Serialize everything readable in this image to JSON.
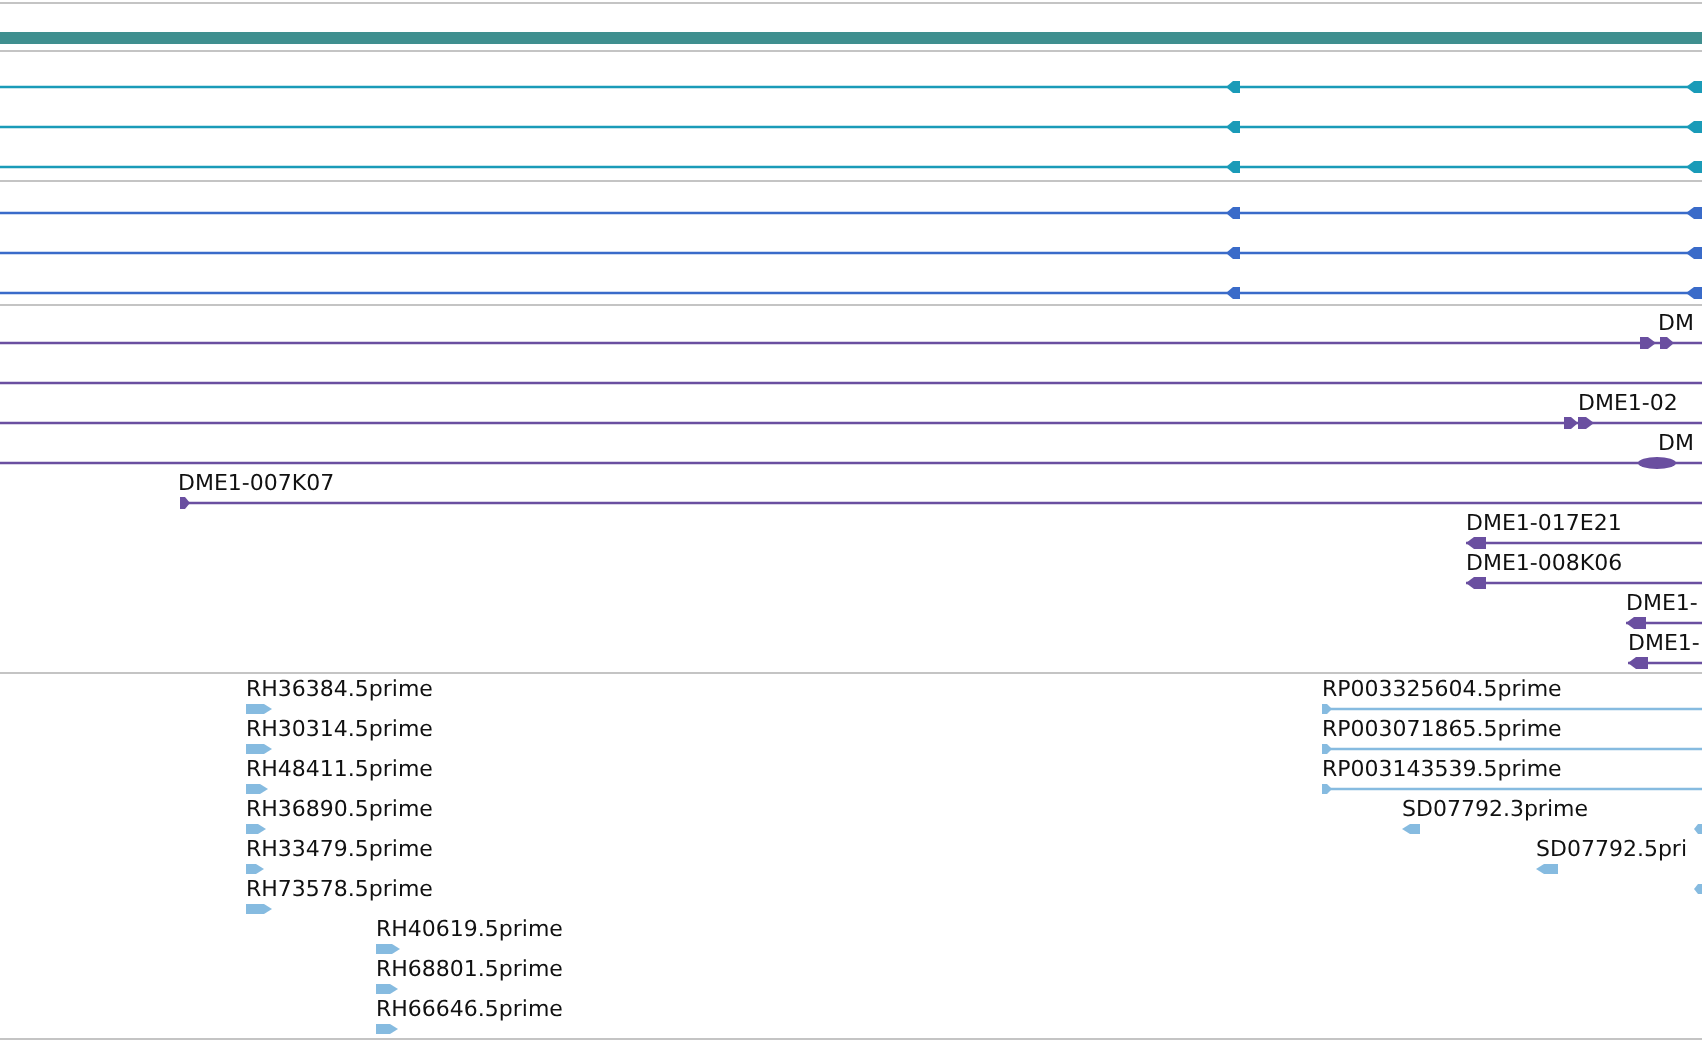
{
  "tracks": [
    {
      "color": "#1a9bb8",
      "features": [
        {
          "kind": "reverse"
        },
        {
          "kind": "reverse"
        },
        {
          "kind": "reverse"
        }
      ]
    },
    {
      "color": "#3a6bc9",
      "features": [
        {
          "kind": "reverse"
        },
        {
          "kind": "reverse"
        },
        {
          "kind": "reverse"
        }
      ]
    },
    {
      "color": "#6a4fa0",
      "features": [
        {
          "label": "DM",
          "kind": "forward"
        },
        {
          "kind": "forward"
        },
        {
          "label": "DME1-02",
          "kind": "forward"
        },
        {
          "label": "DM",
          "kind": "forward"
        },
        {
          "label": "DME1-007K07",
          "kind": "forward"
        },
        {
          "label": "DME1-017E21",
          "kind": "reverse"
        },
        {
          "label": "DME1-008K06",
          "kind": "reverse"
        },
        {
          "label": "DME1-",
          "kind": "reverse"
        },
        {
          "label": "DME1-",
          "kind": "reverse"
        }
      ]
    },
    {
      "color": "#86bbe0",
      "features": [
        {
          "label": "RH36384.5prime",
          "kind": "forward"
        },
        {
          "label": "RH30314.5prime",
          "kind": "forward"
        },
        {
          "label": "RH48411.5prime",
          "kind": "forward"
        },
        {
          "label": "RH36890.5prime",
          "kind": "forward"
        },
        {
          "label": "RH33479.5prime",
          "kind": "forward"
        },
        {
          "label": "RH73578.5prime",
          "kind": "forward"
        },
        {
          "label": "RH40619.5prime",
          "kind": "forward"
        },
        {
          "label": "RH68801.5prime",
          "kind": "forward"
        },
        {
          "label": "RH66646.5prime",
          "kind": "forward"
        },
        {
          "label": "RP003325604.5prime",
          "kind": "forward"
        },
        {
          "label": "RP003071865.5prime",
          "kind": "forward"
        },
        {
          "label": "RP003143539.5prime",
          "kind": "forward"
        },
        {
          "label": "SD07792.3prime",
          "kind": "reverse"
        },
        {
          "kind": "reverse"
        },
        {
          "label": "SD07792.5pri",
          "kind": "reverse"
        },
        {
          "kind": "reverse"
        }
      ]
    }
  ]
}
